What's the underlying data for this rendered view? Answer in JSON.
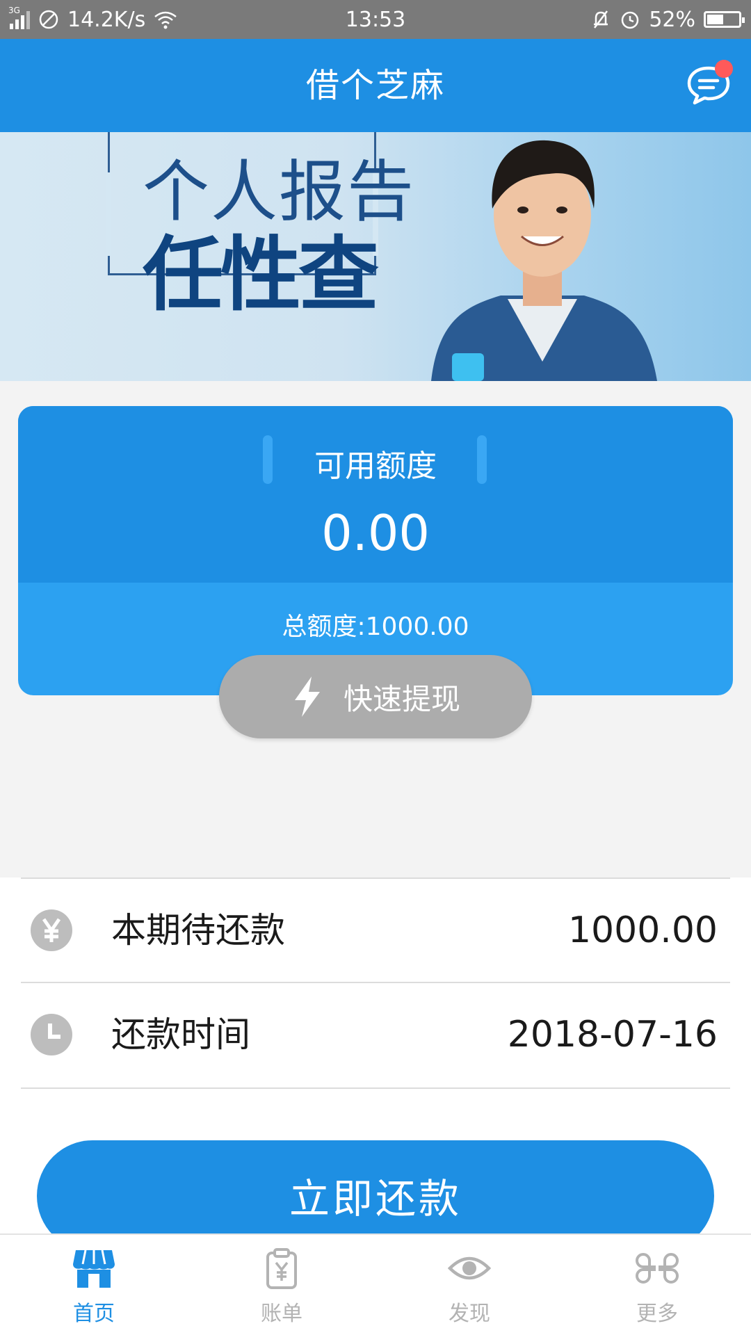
{
  "status_bar": {
    "network_type": "3G",
    "speed": "14.2K/s",
    "time": "13:53",
    "battery": "52%",
    "battery_level": 0.52
  },
  "header": {
    "title": "借个芝麻",
    "message_icon": "chat-bubble-icon"
  },
  "banner": {
    "line1": "个人报告",
    "line2": "任性查"
  },
  "credit": {
    "available_label": "可用额度",
    "available_value": "0.00",
    "total_label": "总额度:1000.00",
    "withdraw_label": "快速提现",
    "withdraw_icon": "lightning-icon"
  },
  "info": {
    "rows": [
      {
        "icon": "yen-icon",
        "label": "本期待还款",
        "value": "1000.00"
      },
      {
        "icon": "clock-icon",
        "label": "还款时间",
        "value": "2018-07-16"
      }
    ]
  },
  "repay_button": "立即还款",
  "tabs": [
    {
      "label": "首页",
      "icon": "store-icon",
      "active": true
    },
    {
      "label": "账单",
      "icon": "bill-icon",
      "active": false
    },
    {
      "label": "发现",
      "icon": "eye-icon",
      "active": false
    },
    {
      "label": "更多",
      "icon": "more-icon",
      "active": false
    }
  ],
  "colors": {
    "primary": "#1e8fe3",
    "card_lower": "#2ca1f1",
    "disabled_button": "#acacac",
    "badge": "#ff5a5a"
  }
}
